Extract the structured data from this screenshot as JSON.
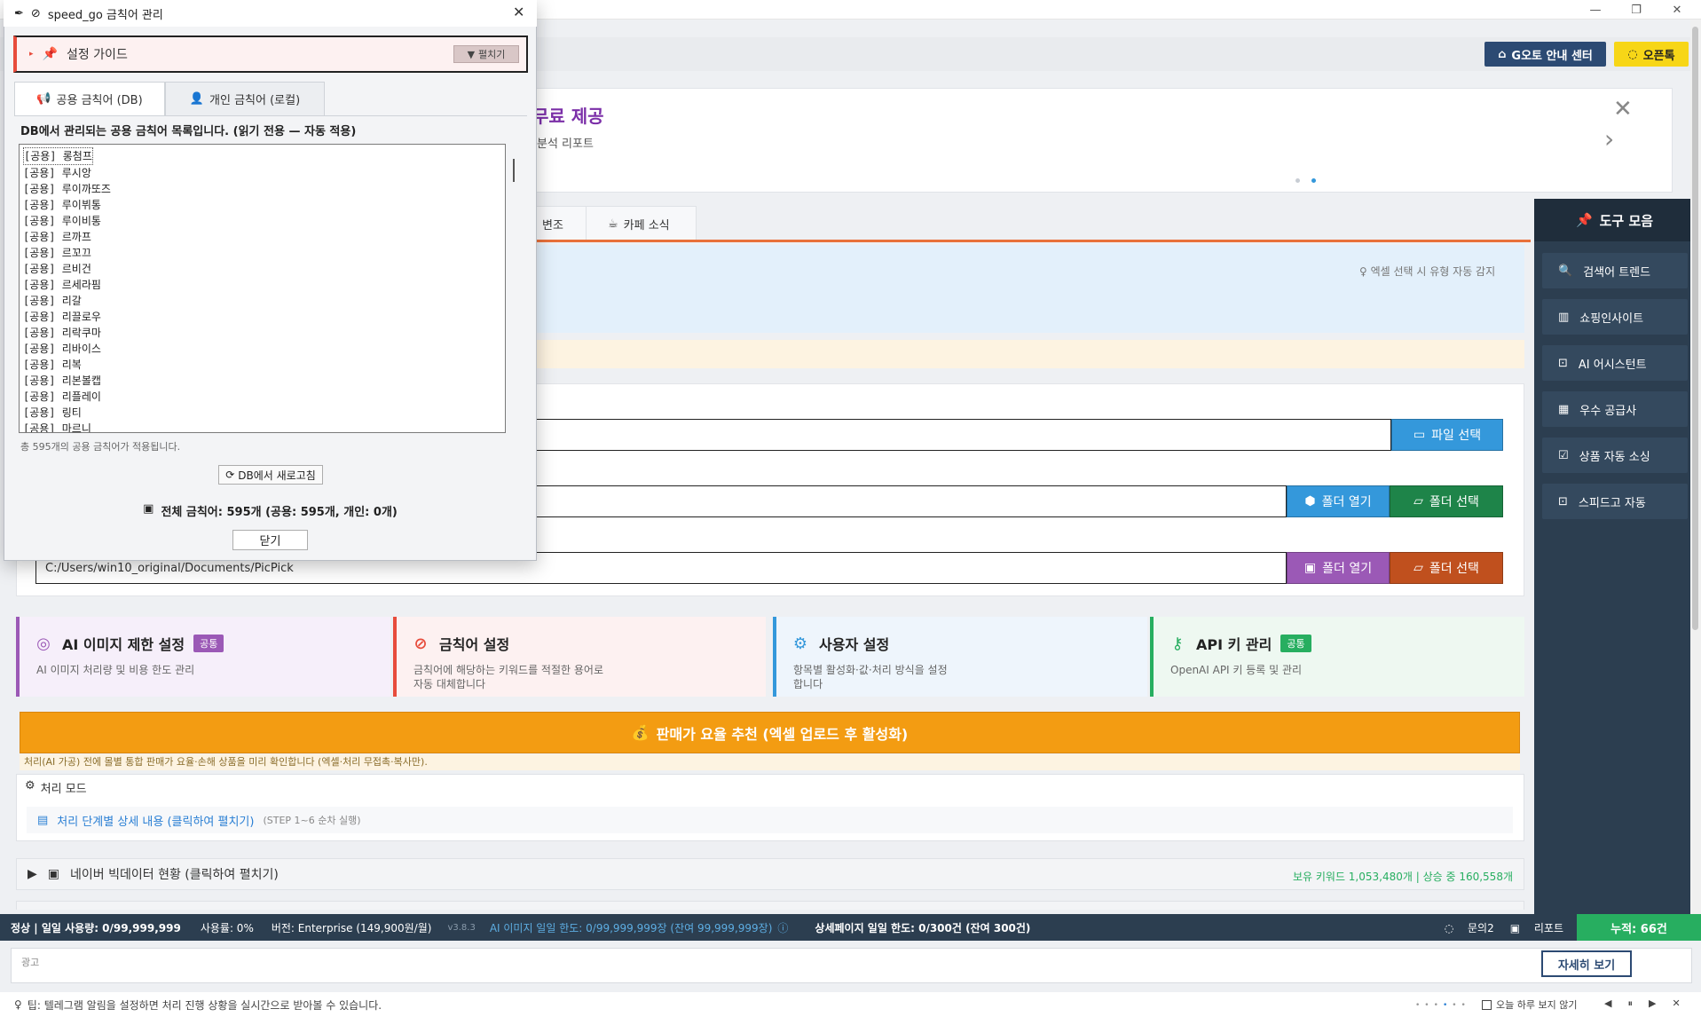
{
  "main": {
    "top_buttons": {
      "guide_center": "G오토 안내 센터",
      "openchat": "오픈톡"
    },
    "banner": {
      "title": "무료 제공",
      "subtitle": "분석 리포트"
    },
    "tabs": [
      {
        "label": "변조"
      },
      {
        "label": "카페 소식"
      }
    ],
    "excel_hint": "엑셀 선택 시 유형 자동 감지",
    "paths": {
      "file_select": "파일 선택",
      "folder_open": "폴더 열기",
      "folder_select": "폴더 선택",
      "pic_path": "C:/Users/win10_original/Documents/PicPick"
    },
    "cards": [
      {
        "title": "AI 이미지 제한 설정",
        "badge": "공통",
        "desc": "AI 이미지 처리량 및 비용 한도 관리",
        "accent": "#9b59b6",
        "bg": "#f6effa"
      },
      {
        "title": "금칙어 설정",
        "badge": "",
        "desc": "금칙어에 해당하는 키워드를 적절한 용어로 자동 대체합니다",
        "accent": "#e74c3c",
        "bg": "#fdf1f1"
      },
      {
        "title": "사용자 설정",
        "badge": "",
        "desc": "항목별 활성화·값·처리 방식을 설정합니다",
        "accent": "#3498db",
        "bg": "#eef5fc"
      },
      {
        "title": "API 키 관리",
        "badge": "공통",
        "desc": "OpenAI API 키 등록 및 관리",
        "accent": "#27ae60",
        "bg": "#eef8f1"
      }
    ],
    "recommend": {
      "label": "판매가 요율 추천 (엑셀 업로드 후 활성화)",
      "note": "처리(AI 가공) 전에 몰별 통합 판매가 요율·손해 상품을 미리 확인합니다 (엑셀·처리 무접촉·복사만)."
    },
    "mode": {
      "label": "처리 모드",
      "steps_link": "처리 단계별 상세 내용 (클릭하여 펼치기)",
      "steps_hint": "(STEP 1~6 순차 실행)"
    },
    "bigdata": {
      "label": "네이버 빅데이터 현황 (클릭하여 펼치기)",
      "stat": "보유 키워드 1,053,480개 | 상승 중 160,558개"
    }
  },
  "toolbar": {
    "title": "도구 모음",
    "items": [
      {
        "label": "검색어 트렌드",
        "icon": "search-icon"
      },
      {
        "label": "쇼핑인사이트",
        "icon": "chart-icon"
      },
      {
        "label": "AI 어시스턴트",
        "icon": "robot-icon"
      },
      {
        "label": "우수 공급사",
        "icon": "building-icon"
      },
      {
        "label": "상품 자동 소싱",
        "icon": "check-icon"
      },
      {
        "label": "스피드고 자동",
        "icon": "robot-icon"
      }
    ]
  },
  "status": {
    "left": "정상 | 일일 사용량: 0/99,999,999",
    "usage": "사용률: 0%",
    "version": "버전: Enterprise (149,900원/월)",
    "ver_no": "v3.8.3",
    "ai_limit": "AI 이미지 일일 한도: 0/99,999,999장 (잔여 99,999,999장)",
    "detail_limit": "상세페이지 일일 한도: 0/300건 (잔여 300건)",
    "inquiry": "문의2",
    "report": "리포트",
    "accumulated": "누적: 66건"
  },
  "ad": {
    "label": "광고",
    "detail": "자세히 보기"
  },
  "tip": {
    "text": "팁: 텔레그램 알림을 설정하면 처리 진행 상황을 실시간으로 받아볼 수 있습니다.",
    "hide_today": "오늘 하루 보지 않기"
  },
  "dialog": {
    "title": "speed_go 금칙어 관리",
    "guide_label": "설정 가이드",
    "expand": "펼치기",
    "tab_public": "공용 금칙어 (DB)",
    "tab_private": "개인 금칙어 (로컬)",
    "list_heading": "DB에서 관리되는 공용 금칙어 목록입니다. (읽기 전용 — 자동 적용)",
    "words": [
      "[공용] 롱첨프",
      "[공용] 루시앙",
      "[공용] 루이까또즈",
      "[공용] 루이뷔통",
      "[공용] 루이비통",
      "[공용] 르까프",
      "[공용] 르꼬끄",
      "[공용] 르비건",
      "[공용] 르세라핌",
      "[공용] 리갈",
      "[공용] 리끌로우",
      "[공용] 리락쿠마",
      "[공용] 리바이스",
      "[공용] 리복",
      "[공용] 리본볼캡",
      "[공용] 리플레이",
      "[공용] 링티",
      "[공용] 마르니"
    ],
    "total_public": "총 595개의 공용 금칙어가 적용됩니다.",
    "refresh": "DB에서 새로고침",
    "total_all": "전체 금칙어: 595개 (공용: 595개, 개인: 0개)",
    "close": "닫기"
  }
}
